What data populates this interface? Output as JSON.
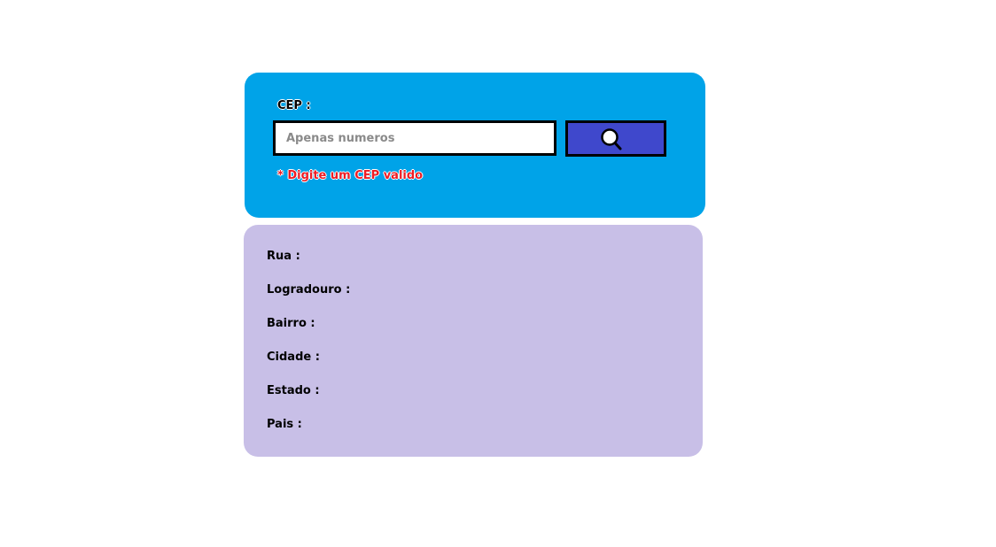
{
  "search": {
    "label": "CEP :",
    "placeholder": "Apenas numeros",
    "value": "",
    "button_icon": "search-icon",
    "error": "* Digite um CEP valido"
  },
  "result": {
    "fields": [
      {
        "label": "Rua :"
      },
      {
        "label": "Logradouro :"
      },
      {
        "label": "Bairro :"
      },
      {
        "label": "Cidade :"
      },
      {
        "label": "Estado :"
      },
      {
        "label": "Pais :"
      }
    ]
  },
  "colors": {
    "search_card": "#00a3e8",
    "search_button": "#3f48cc",
    "result_card": "#c8bfe7",
    "error": "#ed1c24"
  }
}
